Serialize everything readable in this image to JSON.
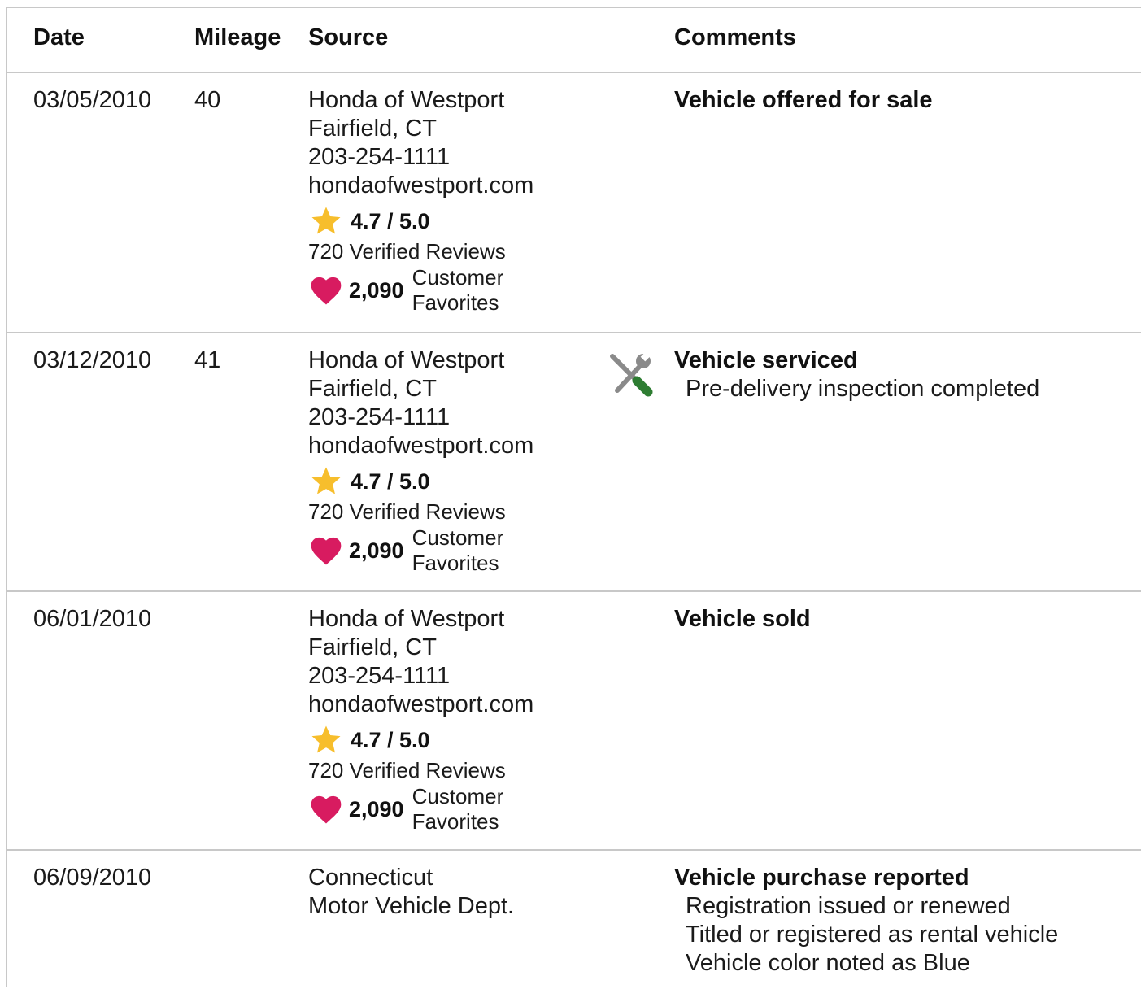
{
  "header": {
    "date": "Date",
    "mileage": "Mileage",
    "source": "Source",
    "comments": "Comments"
  },
  "rows": [
    {
      "date": "03/05/2010",
      "mileage": "40",
      "source": {
        "name": "Honda of Westport",
        "location": "Fairfield, CT",
        "phone": "203-254-1111",
        "website": "hondaofwestport.com",
        "rating": "4.7 / 5.0",
        "reviews": "720 Verified Reviews",
        "favorites_count": "2,090",
        "favorites_label_1": "Customer",
        "favorites_label_2": "Favorites"
      },
      "comment_title": "Vehicle offered for sale"
    },
    {
      "date": "03/12/2010",
      "mileage": "41",
      "icon": "service-tools-icon",
      "source": {
        "name": "Honda of Westport",
        "location": "Fairfield, CT",
        "phone": "203-254-1111",
        "website": "hondaofwestport.com",
        "rating": "4.7 / 5.0",
        "reviews": "720 Verified Reviews",
        "favorites_count": "2,090",
        "favorites_label_1": "Customer",
        "favorites_label_2": "Favorites"
      },
      "comment_title": "Vehicle serviced",
      "comment_details": [
        "Pre-delivery inspection completed"
      ]
    },
    {
      "date": "06/01/2010",
      "mileage": "",
      "source": {
        "name": "Honda of Westport",
        "location": "Fairfield, CT",
        "phone": "203-254-1111",
        "website": "hondaofwestport.com",
        "rating": "4.7 / 5.0",
        "reviews": "720 Verified Reviews",
        "favorites_count": "2,090",
        "favorites_label_1": "Customer",
        "favorites_label_2": "Favorites"
      },
      "comment_title": "Vehicle sold"
    },
    {
      "date": "06/09/2010",
      "mileage": "",
      "source": {
        "name": "Connecticut",
        "location": "Motor Vehicle Dept."
      },
      "comment_title": "Vehicle purchase reported",
      "comment_details": [
        "Registration issued or renewed",
        "Titled or registered as rental vehicle",
        "Vehicle color noted as Blue"
      ]
    }
  ],
  "colors": {
    "star": "#f7be2c",
    "heart": "#d81b60",
    "divider": "#c8c8c8",
    "wrench_handle": "#2e7d32",
    "tool_metal": "#8a8a8a"
  }
}
